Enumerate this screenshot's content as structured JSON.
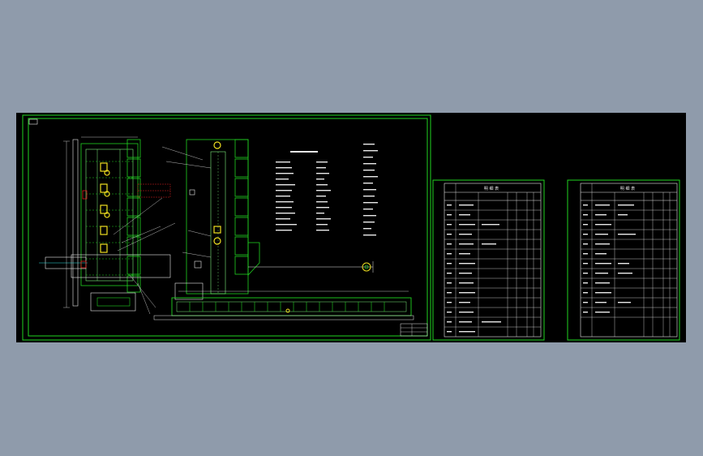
{
  "drawing": {
    "main_sheet": {
      "title_block_lines": 4
    },
    "parts_lists": [
      {
        "id": "parts-list-1",
        "header": "明 细 表",
        "rows": 16
      },
      {
        "id": "parts-list-2",
        "header": "明 细 表",
        "rows": 15
      }
    ]
  },
  "colors": {
    "viewport_bg": "#000000",
    "frame": "#21d321",
    "lines": "#e8e8e8",
    "highlight": "#f0e020",
    "hatch": "#e02020",
    "accent": "#30e0e0",
    "desktop": "#8f9bab"
  }
}
